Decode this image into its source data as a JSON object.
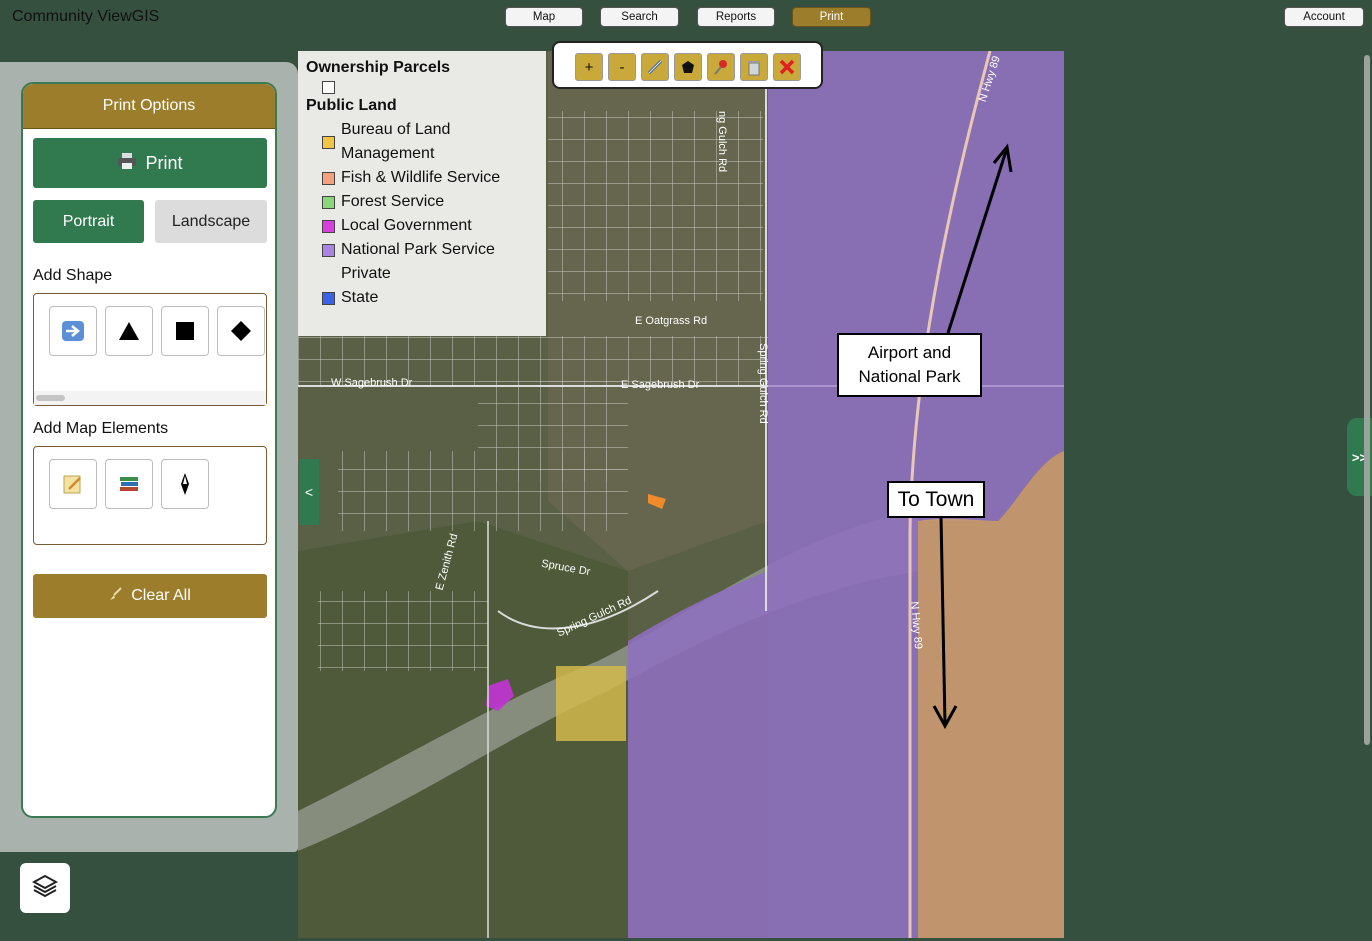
{
  "app": {
    "title": "Community ViewGIS"
  },
  "nav": [
    {
      "label": "Map",
      "active": false
    },
    {
      "label": "Search",
      "active": false
    },
    {
      "label": "Reports",
      "active": false
    },
    {
      "label": "Print",
      "active": true
    }
  ],
  "account_label": "Account",
  "print_panel": {
    "header": "Print Options",
    "print_label": "Print",
    "portrait_label": "Portrait",
    "landscape_label": "Landscape",
    "orientation_selected": "Portrait",
    "add_shape_label": "Add Shape",
    "shapes": [
      "arrow-icon",
      "triangle-icon",
      "square-icon",
      "diamond-icon"
    ],
    "add_elements_label": "Add Map Elements",
    "elements": [
      "text-note-icon",
      "legend-books-icon",
      "north-arrow-icon"
    ],
    "clear_label": "Clear All"
  },
  "legend": {
    "ownership_title": "Ownership Parcels",
    "public_title": "Public Land",
    "items": [
      {
        "label": "Bureau of Land",
        "label2": "Management",
        "color": "#f2c445"
      },
      {
        "label": "Fish & Wildlife Service",
        "color": "#f4a27e"
      },
      {
        "label": "Forest Service",
        "color": "#8bd67a"
      },
      {
        "label": "Local Government",
        "color": "#d63ee0"
      },
      {
        "label": "National Park Service",
        "color": "#a886e0"
      },
      {
        "label": "Private",
        "color": ""
      },
      {
        "label": "State",
        "color": "#3c63e6"
      }
    ]
  },
  "toolbar": {
    "zoom_in": "+",
    "zoom_out": "-",
    "tools": [
      "measure-icon",
      "polygon-icon",
      "pin-icon",
      "trash-icon",
      "close-icon"
    ]
  },
  "map": {
    "roads": [
      "N Hwy 89",
      "E Oatgrass Rd",
      "Spring Gulch Rd",
      "W Sagebrush Dr",
      "E Sagebrush Dr",
      "E Zenith Rd",
      "Spruce Dr",
      "Spring Gulch Rd"
    ],
    "road_labels": {
      "hwy_top": "N Hwy 89",
      "gulch_top": "ng Gulch Rd",
      "oatgrass": "E Oatgrass Rd",
      "gulch_mid": "Spring Gulch Rd",
      "sage_w": "W Sagebrush Dr",
      "sage_e": "E Sagebrush Dr",
      "zenith": "E Zenith Rd",
      "spruce": "Spruce Dr",
      "gulch_low": "Spring Gulch Rd",
      "hwy_mid": "N Hwy 89"
    },
    "annotations": {
      "airport_line1": "Airport and",
      "airport_line2": "National Park",
      "town": "To Town"
    }
  },
  "colors": {
    "accent_green": "#317a4f",
    "accent_gold": "#9b7d2b",
    "nps_purple": "#8e6fc0",
    "fws_orange": "#d9a27a"
  },
  "side_tab": {
    "collapse": "<",
    "expand": ">>"
  }
}
